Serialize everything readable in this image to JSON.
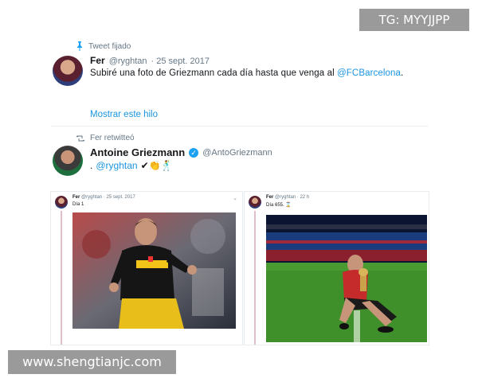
{
  "overlay": {
    "tg_label": "TG: MYYJJPP",
    "site_label": "www.shengtianjc.com"
  },
  "tweet1": {
    "context": "Tweet fijado",
    "name": "Fer",
    "handle": "@ryghtan",
    "date": "· 25 sept. 2017",
    "text": "Subiré una foto de Griezmann cada día hasta que venga al ",
    "mention": "@FCBarcelona",
    "text_end": ".",
    "show_thread": "Mostrar este hilo"
  },
  "tweet2": {
    "context": "Fer retwitteó",
    "name": "Antoine Griezmann",
    "handle": "@AntoGriezmann",
    "body_prefix": ".",
    "mention": "@ryghtan",
    "emojis": "✔👏🕺"
  },
  "cards": {
    "left": {
      "name": "Fer",
      "handle": "@ryghtan",
      "date": "· 25 sept. 2017",
      "text": "Día 1"
    },
    "right": {
      "name": "Fer",
      "handle": "@ryghtan",
      "date": "· 22 h",
      "text": "Día 655. ⌛"
    }
  },
  "colors": {
    "link": "#1b95e0",
    "verified": "#1da1f2"
  }
}
